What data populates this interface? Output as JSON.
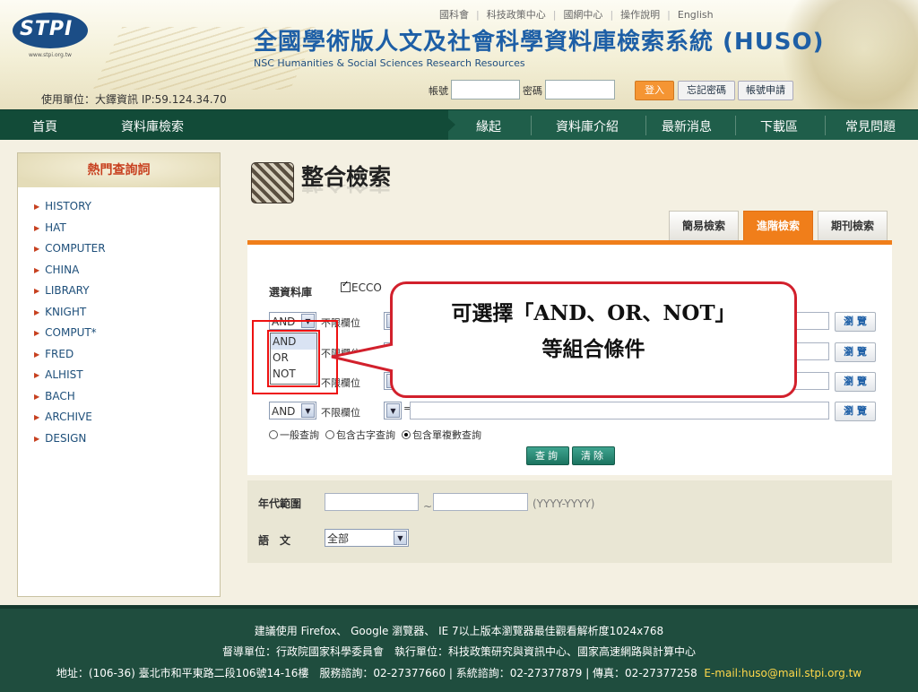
{
  "header": {
    "logo_text": "STPI",
    "logo_url": "www.stpi.org.tw",
    "user_unit": "使用單位：大鐸資訊 IP:59.124.34.70",
    "title": "全國學術版人文及社會科學資料庫檢索系統 (HUSO)",
    "subtitle": "NSC Humanities & Social Sciences Research Resources",
    "top_links": [
      "國科會",
      "科技政策中心",
      "國網中心",
      "操作說明",
      "English"
    ],
    "account_label": "帳號",
    "password_label": "密碼",
    "login_button": "登入",
    "forgot_button": "忘記密碼",
    "apply_button": "帳號申請"
  },
  "nav": {
    "left": [
      "首頁",
      "資料庫檢索"
    ],
    "right": [
      "緣起",
      "資料庫介紹",
      "最新消息",
      "下載區",
      "常見問題"
    ]
  },
  "sidebar": {
    "title": "熱門查詢詞",
    "items": [
      "HISTORY",
      "HAT",
      "COMPUTER",
      "CHINA",
      "LIBRARY",
      "KNIGHT",
      "COMPUT*",
      "FRED",
      "ALHIST",
      "BACH",
      "ARCHIVE",
      "DESIGN"
    ]
  },
  "main": {
    "title": "整合檢索",
    "tabs": [
      "簡易檢索",
      "進階檢索",
      "期刊檢索"
    ],
    "active_tab": "進階檢索",
    "db_label": "選資料庫",
    "db_option": "ECCO",
    "rows": [
      {
        "op": "AND",
        "field": "不限欄位",
        "browse": "瀏 覽"
      },
      {
        "op": "AND",
        "field": "不限欄位",
        "browse": "瀏 覽"
      },
      {
        "op": "AND",
        "field": "不限欄位",
        "browse": "瀏 覽"
      },
      {
        "op": "AND",
        "field": "不限欄位",
        "browse": "瀏 覽"
      }
    ],
    "dropdown_options": [
      "AND",
      "OR",
      "NOT"
    ],
    "query_options": [
      "一般查詢",
      "包含古字查詢",
      "包含單複數查詢"
    ],
    "query_selected": "包含單複數查詢",
    "search_button": "查詢",
    "clear_button": "清除",
    "year_label": "年代範圍",
    "year_sep": "~",
    "year_hint": "(YYYY-YYYY)",
    "lang_label": "語文",
    "lang_value": "全部"
  },
  "callout": {
    "line1": "可選擇「AND、OR、NOT」",
    "line2": "等組合條件"
  },
  "footer": {
    "line1": "建議使用 Firefox、 Google 瀏覽器、 IE 7以上版本瀏覽器最佳觀看解析度1024x768",
    "line2": "督導單位：行政院國家科學委員會　執行單位：科技政策研究與資訊中心、國家高速網路與計算中心",
    "line3": "地址：(106-36) 臺北市和平東路二段106號14-16樓　服務諮詢：02-27377660 | 系統諮詢：02-27377879 | 傳真：02-27377258",
    "email": "E-mail:huso@mail.stpi.org.tw"
  }
}
